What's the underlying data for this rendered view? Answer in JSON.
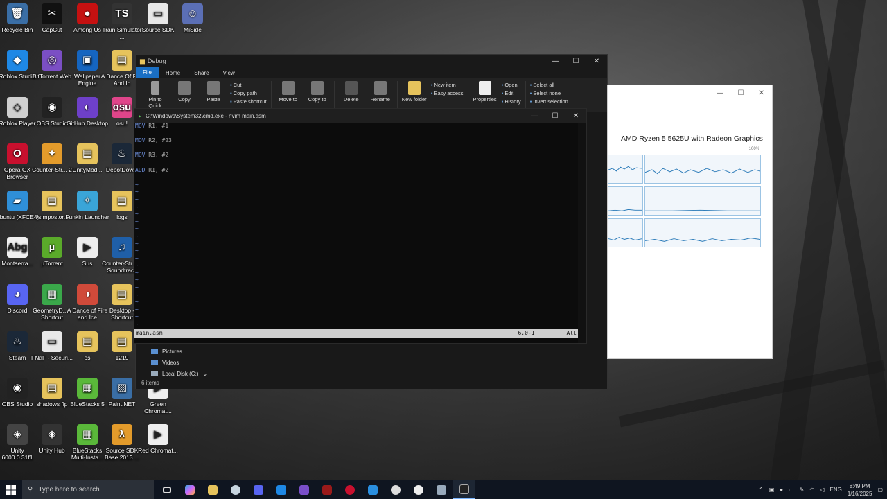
{
  "desktop": {
    "icons": [
      {
        "label": "Recycle Bin",
        "glyph": "🗑",
        "color": "#3a6ea5"
      },
      {
        "label": "CapCut",
        "glyph": "✂",
        "color": "#111111"
      },
      {
        "label": "Among Us",
        "glyph": "●",
        "color": "#c51111"
      },
      {
        "label": "Train Simulator ...",
        "glyph": "TS",
        "color": "#333333"
      },
      {
        "label": "Source SDK",
        "glyph": "▭",
        "color": "#e8e8e8"
      },
      {
        "label": "MiSide",
        "glyph": "☺",
        "color": "#5b6fb5"
      },
      {
        "label": "Roblox Studio",
        "glyph": "◆",
        "color": "#1e88e5"
      },
      {
        "label": "BitTorrent Web",
        "glyph": "◎",
        "color": "#7b4fc4"
      },
      {
        "label": "Wallpaper Engine",
        "glyph": "▣",
        "color": "#1565c0"
      },
      {
        "label": "A Dance Of Fire And Ic",
        "glyph": "▤",
        "color": "#e6c35c"
      },
      {
        "label": "Roblox Player",
        "glyph": "◇",
        "color": "#d0d0d0"
      },
      {
        "label": "OBS Studio",
        "glyph": "◉",
        "color": "#222222"
      },
      {
        "label": "GitHub Desktop",
        "glyph": "◐",
        "color": "#6e40c9"
      },
      {
        "label": "osu!",
        "glyph": "osu",
        "color": "#e0458a"
      },
      {
        "label": "Opera GX Browser",
        "glyph": "O",
        "color": "#c8102e"
      },
      {
        "label": "Counter-Str... 2",
        "glyph": "✦",
        "color": "#e39b2b"
      },
      {
        "label": "UnityMod...",
        "glyph": "▤",
        "color": "#e6c35c"
      },
      {
        "label": "DepotDow...",
        "glyph": "♨",
        "color": "#1b2838"
      },
      {
        "label": "Ubuntu (XFCE4)",
        "glyph": "▰",
        "color": "#2f8fd8"
      },
      {
        "label": "vsimpostor...",
        "glyph": "▤",
        "color": "#e6c35c"
      },
      {
        "label": "Funkin Launcher",
        "glyph": "✧",
        "color": "#3aa5d8"
      },
      {
        "label": "logs",
        "glyph": "▤",
        "color": "#e6c35c"
      },
      {
        "label": "Montserra...",
        "glyph": "Abg",
        "color": "#f0f0f0"
      },
      {
        "label": "µTorrent",
        "glyph": "µ",
        "color": "#5aaa2a"
      },
      {
        "label": "Sus",
        "glyph": "▶",
        "color": "#eeeeee"
      },
      {
        "label": "Counter-Str... 2 Soundtrack",
        "glyph": "♫",
        "color": "#1f5fa8"
      },
      {
        "label": "Discord",
        "glyph": "◕",
        "color": "#5865f2"
      },
      {
        "label": "GeometryD... - Shortcut",
        "glyph": "▦",
        "color": "#3aa84a"
      },
      {
        "label": "A Dance of Fire and Ice",
        "glyph": "◑",
        "color": "#d04a3a"
      },
      {
        "label": "Desktop - Shortcut",
        "glyph": "▤",
        "color": "#e6c35c"
      },
      {
        "label": "Steam",
        "glyph": "♨",
        "color": "#1b2838"
      },
      {
        "label": "FNaF - Securi...",
        "glyph": "▭",
        "color": "#e8e8e8"
      },
      {
        "label": "os",
        "glyph": "▤",
        "color": "#e6c35c"
      },
      {
        "label": "1219",
        "glyph": "▤",
        "color": "#e6c35c"
      },
      {
        "label": "OBS Studio",
        "glyph": "◉",
        "color": "#222222"
      },
      {
        "label": "shadows flp",
        "glyph": "▤",
        "color": "#e6c35c"
      },
      {
        "label": "BlueStacks 5",
        "glyph": "▦",
        "color": "#5ab83a"
      },
      {
        "label": "Paint.NET",
        "glyph": "▨",
        "color": "#3a6ea5"
      },
      {
        "label": "Green Chromat...",
        "glyph": "▶",
        "color": "#eeeeee"
      },
      {
        "label": "Unity 6000.0.31f1",
        "glyph": "◈",
        "color": "#444444"
      },
      {
        "label": "Unity Hub",
        "glyph": "◈",
        "color": "#333333"
      },
      {
        "label": "BlueStacks Multi-Insta...",
        "glyph": "▦",
        "color": "#5ab83a"
      },
      {
        "label": "Source SDK Base 2013 ...",
        "glyph": "λ",
        "color": "#e39b2b"
      },
      {
        "label": "Red Chromat...",
        "glyph": "▶",
        "color": "#eeeeee"
      }
    ]
  },
  "explorer": {
    "title": "Debug",
    "tabs": [
      "File",
      "Home",
      "Share",
      "View"
    ],
    "ribbon": {
      "pin": "Pin to Quick access",
      "copy": "Copy",
      "paste": "Paste",
      "cut": "Cut",
      "copy_path": "Copy path",
      "paste_shortcut": "Paste shortcut",
      "move_to": "Move to",
      "copy_to": "Copy to",
      "delete": "Delete",
      "rename": "Rename",
      "new_folder": "New folder",
      "new_item": "New item",
      "easy_access": "Easy access",
      "properties": "Properties",
      "open": "Open",
      "edit": "Edit",
      "history": "History",
      "select_all": "Select all",
      "select_none": "Select none",
      "invert_selection": "Invert selection"
    },
    "nav": [
      "Pictures",
      "Videos",
      "Local Disk (C:)"
    ],
    "status": "6 items"
  },
  "terminal": {
    "title": "C:\\Windows\\System32\\cmd.exe - nvim  main.asm",
    "lines": [
      {
        "op": "MOV",
        "args": "R1, #1"
      },
      {
        "op": "MOV",
        "args": "R2, #23"
      },
      {
        "op": "MOV",
        "args": "R3, #2"
      },
      {
        "op": "ADD",
        "args": "R1, #2"
      }
    ],
    "tilde": "~",
    "status_file": "main.asm",
    "status_pos": "6,0-1",
    "status_scroll": "All"
  },
  "taskmgr": {
    "cpu_name": "AMD Ryzen 5 5625U with Radeon Graphics",
    "percent_label": "100%"
  },
  "taskbar": {
    "search_placeholder": "Type here to search",
    "language": "ENG",
    "time": "8:49 PM",
    "date": "1/16/2025"
  }
}
